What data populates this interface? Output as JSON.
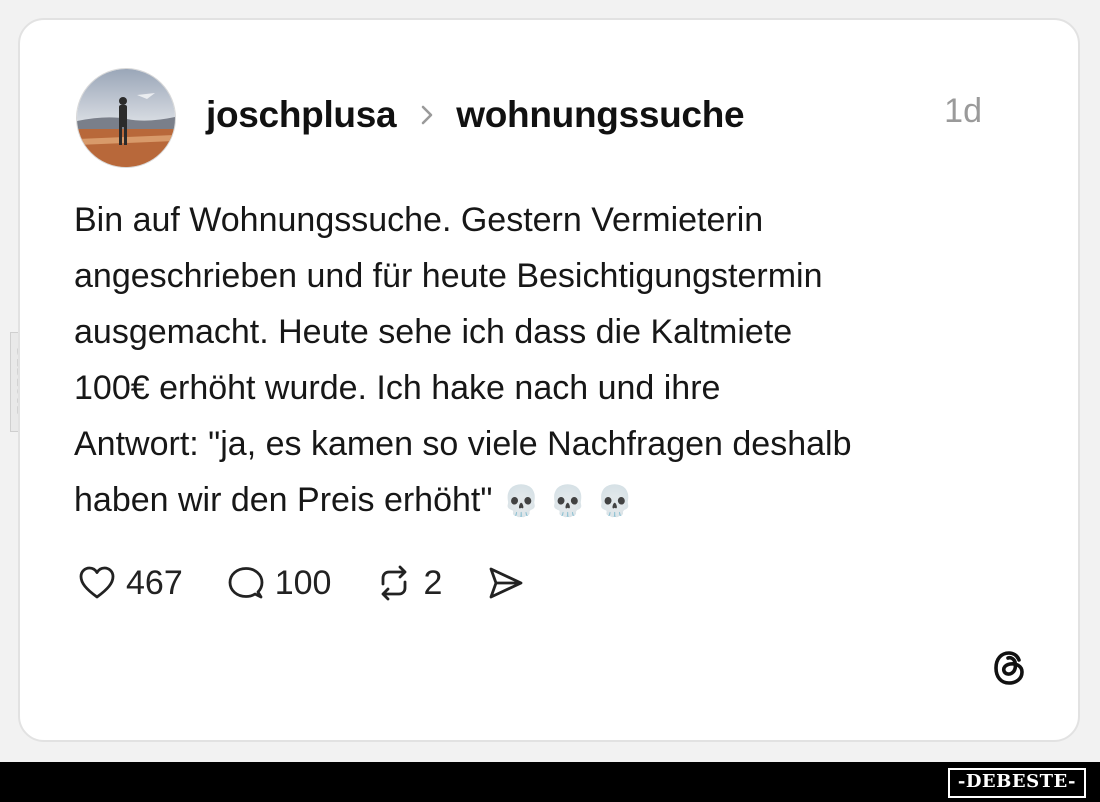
{
  "post": {
    "username": "joschplusa",
    "topic": "wohnungssuche",
    "timestamp": "1d",
    "text_lines": [
      "Bin auf Wohnungssuche. Gestern Vermieterin",
      "angeschrieben und für heute Besichtigungstermin",
      "ausgemacht. Heute sehe ich dass die Kaltmiete",
      "100€ erhöht wurde. Ich hake nach und ihre",
      "Antwort: \"ja, es kamen so viele Nachfragen deshalb",
      "haben wir den Preis erhöht\""
    ],
    "emoji": "💀 💀 💀",
    "likes": "467",
    "comments": "100",
    "reposts": "2"
  },
  "icons": {
    "like": "heart-icon",
    "comment": "comment-bubble-icon",
    "repost": "repost-icon",
    "share": "send-icon",
    "brand": "threads-logo-icon"
  },
  "watermark": {
    "side": "DEBESTE",
    "bottom": "-DEBESTE-"
  }
}
